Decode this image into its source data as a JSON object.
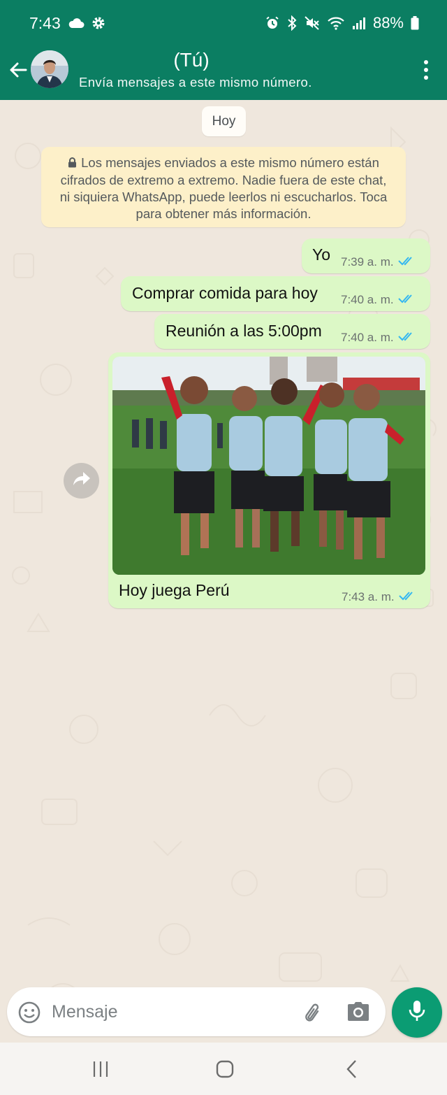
{
  "status_bar": {
    "time": "7:43",
    "battery": "88%",
    "icons": [
      "cloud-icon",
      "settings-icon",
      "alarm-icon",
      "bluetooth-icon",
      "mute-icon",
      "wifi-icon",
      "signal-icon",
      "battery-icon"
    ]
  },
  "header": {
    "name": "(Tú)",
    "subtitle": "Envía mensajes a este mismo número."
  },
  "chat": {
    "date_chip": "Hoy",
    "encryption_notice": "Los mensajes enviados a este mismo número están cifrados de extremo a extremo. Nadie fuera de este chat, ni siquiera WhatsApp, puede leerlos ni escucharlos. Toca para obtener más información.",
    "messages": [
      {
        "text": "Yo",
        "time": "7:39 a. m.",
        "status": "read"
      },
      {
        "text": "Comprar comida para hoy",
        "time": "7:40 a. m.",
        "status": "read"
      },
      {
        "text": "Reunión a las 5:00pm",
        "time": "7:40 a. m.",
        "status": "read"
      },
      {
        "text": "Hoy juega Perú",
        "time": "7:43 a. m.",
        "status": "read",
        "has_image": true
      }
    ]
  },
  "composer": {
    "placeholder": "Mensaje"
  },
  "colors": {
    "header": "#0b7e62",
    "outgoing_bubble": "#dcf8c6",
    "chat_background": "#efe7dd",
    "notice_background": "#fdf0c9",
    "mic_button": "#0b9c73",
    "read_ticks": "#34b7f1"
  }
}
